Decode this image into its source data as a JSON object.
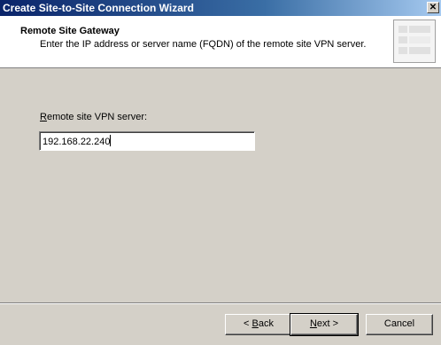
{
  "window": {
    "title": "Create Site-to-Site Connection Wizard",
    "close_glyph": "✕"
  },
  "header": {
    "title": "Remote Site Gateway",
    "subtitle": "Enter the IP address or server name (FQDN) of the remote site VPN server.",
    "icon": "wizard-graphic-icon"
  },
  "form": {
    "label_mnemonic": "R",
    "label_rest": "emote site VPN server:",
    "value": "192.168.22.240"
  },
  "buttons": {
    "back_prefix": "< ",
    "back_mnemonic": "B",
    "back_rest": "ack",
    "next_mnemonic": "N",
    "next_rest": "ext >",
    "cancel": "Cancel"
  }
}
